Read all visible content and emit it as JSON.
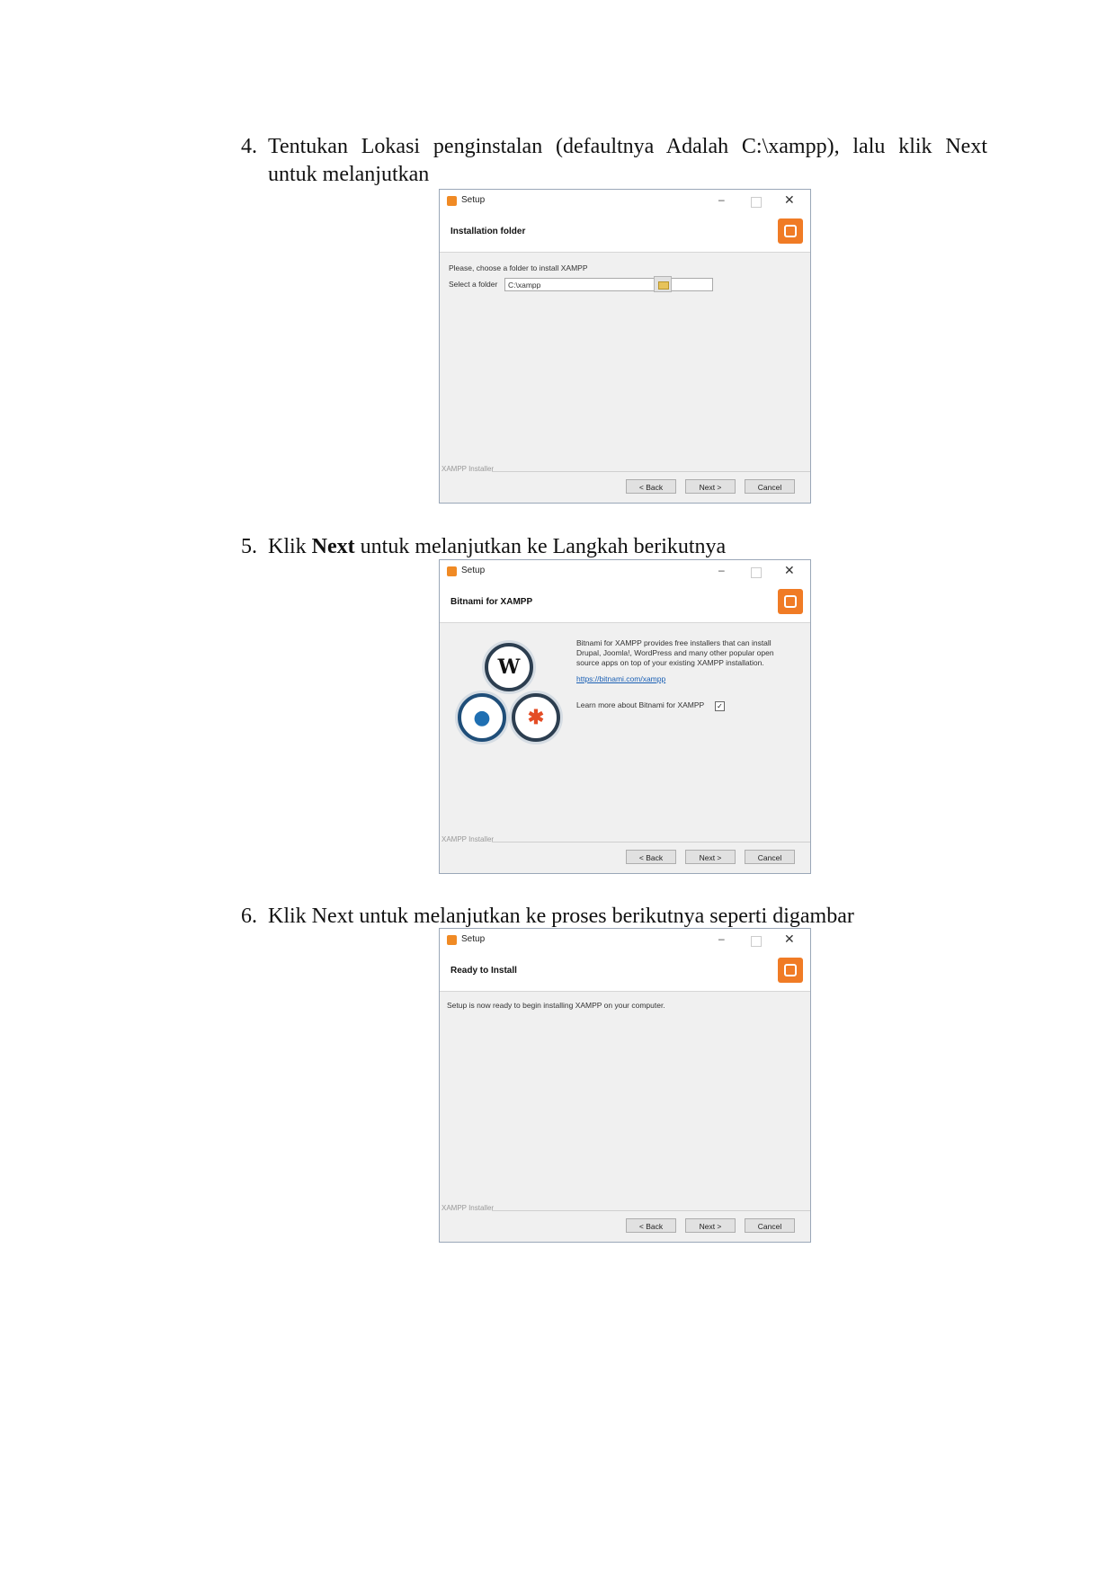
{
  "steps": [
    {
      "number": "4.",
      "line1": "Tentukan Lokasi penginstalan (defaultnya Adalah C:\\xampp), lalu klik Next",
      "line2": "untuk melanjutkan"
    },
    {
      "number": "5.",
      "pre": "Klik ",
      "bold": "Next",
      "post": " untuk melanjutkan ke Langkah berikutnya"
    },
    {
      "number": "6.",
      "text": "Klik Next untuk melanjutkan ke proses berikutnya seperti digambar"
    }
  ],
  "window_common": {
    "title": "Setup",
    "minimize": "–",
    "close": "✕",
    "footer_label": "XAMPP Installer",
    "back": "< Back",
    "next": "Next >",
    "cancel": "Cancel",
    "accent_color": "#f07b25"
  },
  "window1": {
    "header": "Installation folder",
    "prompt": "Please, choose a folder to install XAMPP",
    "field_label": "Select a folder",
    "field_value": "C:\\xampp",
    "browse_icon": "folder-icon"
  },
  "window2": {
    "header": "Bitnami for XAMPP",
    "desc1": "Bitnami for XAMPP provides free installers that can install",
    "desc2": "Drupal, Joomla!, WordPress and many other popular open",
    "desc3": "source apps on top of your existing XAMPP installation.",
    "link": "https://bitnami.com/xampp",
    "checkbox_label": "Learn more about Bitnami for XAMPP",
    "checkbox_checked": true,
    "icons": [
      "wordpress-icon",
      "drupal-icon",
      "joomla-icon"
    ]
  },
  "window3": {
    "header": "Ready to Install",
    "message": "Setup is now ready to begin installing XAMPP on your computer."
  }
}
